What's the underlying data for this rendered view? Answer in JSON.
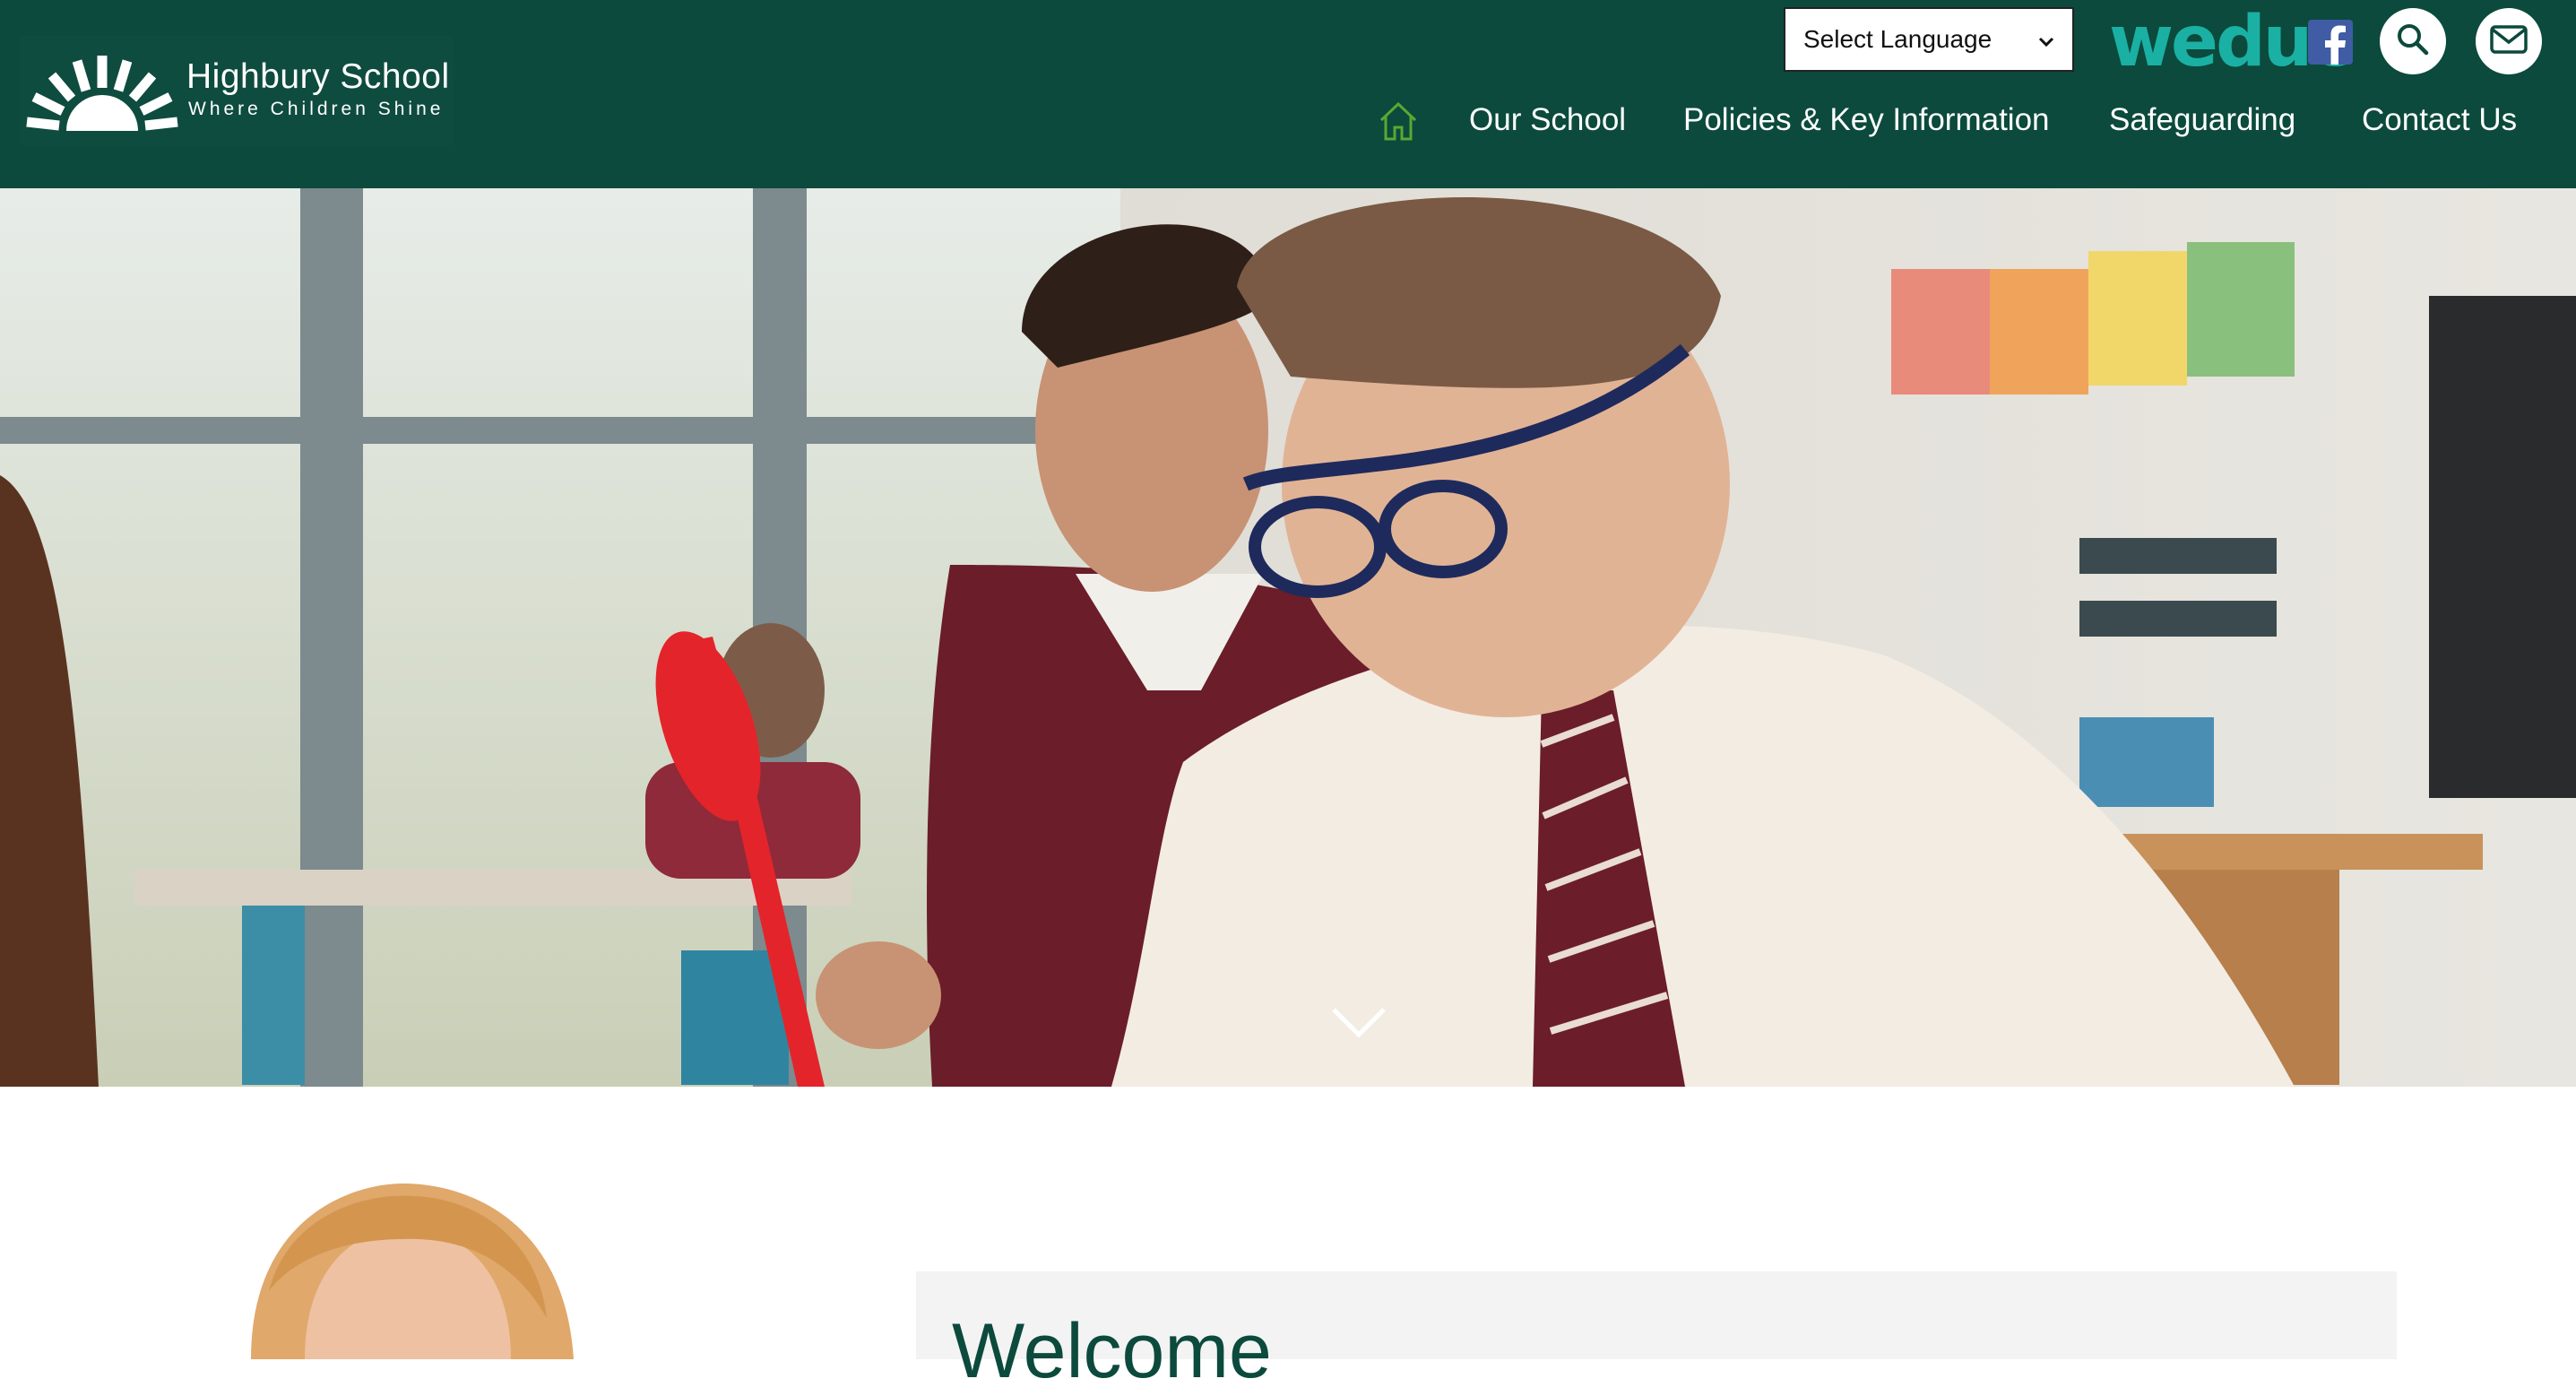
{
  "header": {
    "school_name": "Highbury School",
    "tagline": "Where Children Shine",
    "language_select": "Select Language",
    "weduc_label": "weduc",
    "colors": {
      "header_bg": "#0b4a3c",
      "accent_home": "#5aa832",
      "weduc": "#1ab0a3"
    }
  },
  "nav": {
    "home_icon": "home-icon",
    "items": [
      "Our School",
      "Policies & Key Information",
      "Safeguarding",
      "Contact Us"
    ]
  },
  "icons": {
    "facebook": "facebook-icon",
    "search": "search-icon",
    "mail": "mail-icon",
    "scroll": "chevron-down-icon"
  },
  "welcome": {
    "title": "Welcome"
  }
}
